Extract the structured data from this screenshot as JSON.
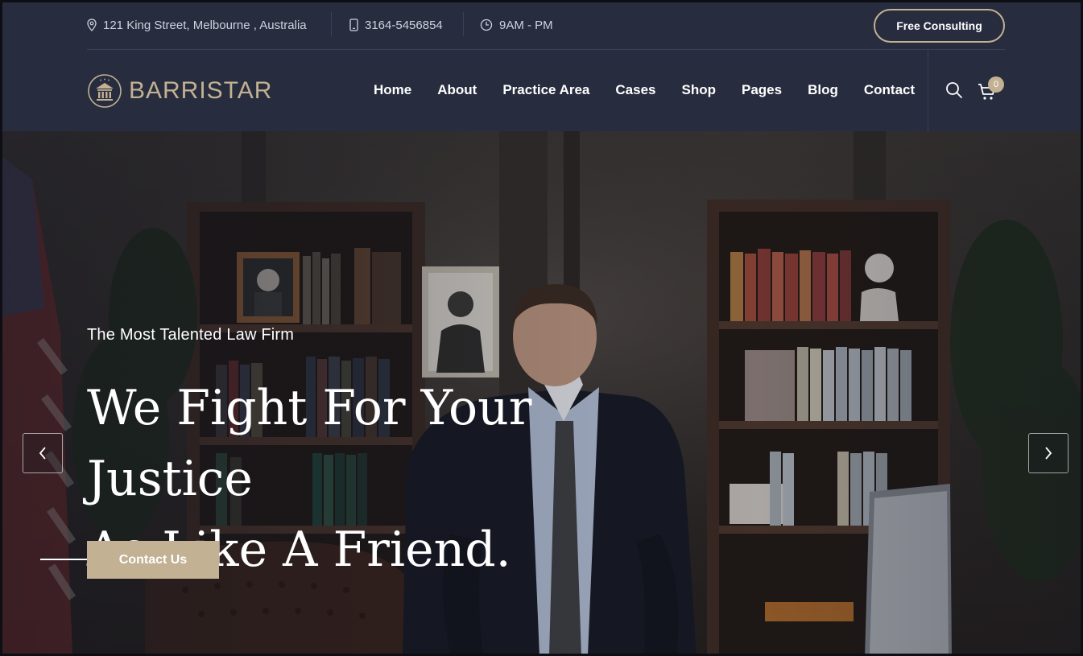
{
  "topbar": {
    "address": "121 King Street, Melbourne , Australia",
    "phone": "3164-5456854",
    "hours": "9AM - PM",
    "consult_label": "Free Consulting"
  },
  "brand": {
    "name": "BARRISTAR",
    "accent_color": "#c2b192",
    "header_bg": "#272c3f"
  },
  "nav": {
    "items": [
      "Home",
      "About",
      "Practice Area",
      "Cases",
      "Shop",
      "Pages",
      "Blog",
      "Contact"
    ],
    "cart_count": "0"
  },
  "hero": {
    "subtitle": "The Most Talented Law Firm",
    "headline_line1": "We Fight For Your Justice",
    "headline_line2": "As Like A Friend.",
    "cta_label": "Contact Us"
  }
}
